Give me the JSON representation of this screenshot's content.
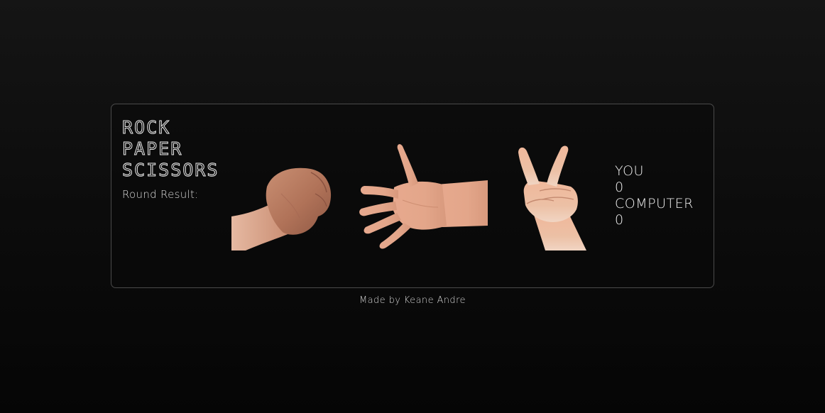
{
  "title": {
    "lines": [
      "ROCK",
      "PAPER",
      "SCISSORS"
    ]
  },
  "round_result_label": "Round Result:",
  "choices": [
    {
      "name": "rock",
      "icon": "rock-hand-icon"
    },
    {
      "name": "paper",
      "icon": "paper-hand-icon"
    },
    {
      "name": "scissors",
      "icon": "scissors-hand-icon"
    }
  ],
  "score": {
    "you_label": "YOU",
    "you_score": "0",
    "computer_label": "COMPUTER",
    "computer_score": "0"
  },
  "footer": "Made by Keane Andre",
  "colors": {
    "background_top": "#151515",
    "background_bottom": "#050505",
    "card_border": "#4a4a4a",
    "text": "#e9e9e9",
    "skin": "#e2a98c"
  }
}
